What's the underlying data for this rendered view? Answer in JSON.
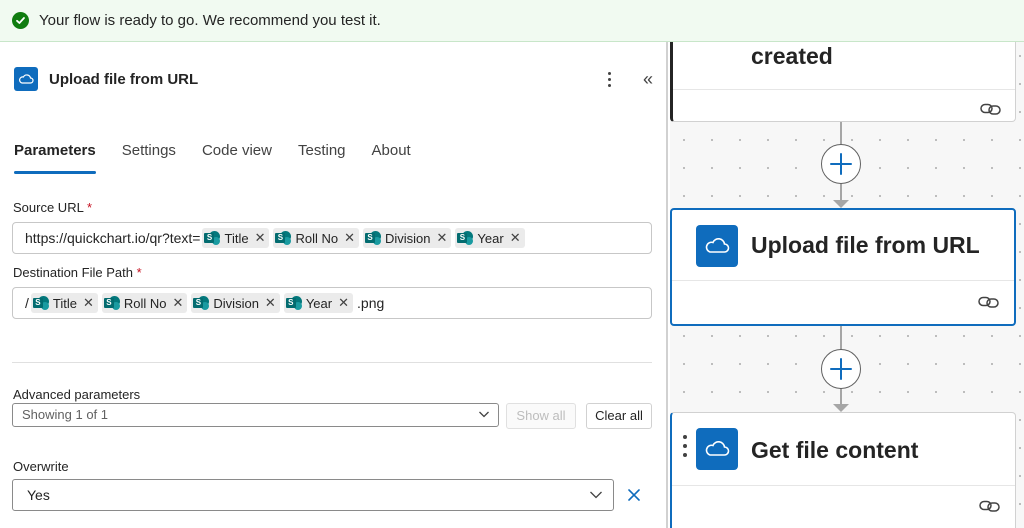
{
  "banner": {
    "message": "Your flow is ready to go. We recommend you test it."
  },
  "panel": {
    "title": "Upload file from URL",
    "tabs": [
      {
        "label": "Parameters",
        "active": true
      },
      {
        "label": "Settings",
        "active": false
      },
      {
        "label": "Code view",
        "active": false
      },
      {
        "label": "Testing",
        "active": false
      },
      {
        "label": "About",
        "active": false
      }
    ],
    "source_url": {
      "label": "Source URL",
      "required_mark": "*",
      "prefix": "https://quickchart.io/qr?text=",
      "tokens": [
        "Title",
        "Roll No",
        "Division",
        "Year"
      ]
    },
    "destination": {
      "label": "Destination File Path",
      "required_mark": "*",
      "prefix": "/",
      "tokens": [
        "Title",
        "Roll No",
        "Division",
        "Year"
      ],
      "suffix": ".png"
    },
    "advanced": {
      "label": "Advanced parameters",
      "selected": "Showing 1 of 1",
      "show_all": "Show all",
      "clear_all": "Clear all"
    },
    "overwrite": {
      "label": "Overwrite",
      "value": "Yes"
    }
  },
  "canvas": {
    "cards": [
      {
        "title": "created"
      },
      {
        "title": "Upload file from URL",
        "selected": true
      },
      {
        "title": "Get file content"
      }
    ]
  },
  "colors": {
    "accent": "#0f6cbd",
    "success": "#107c10",
    "sharepoint": "#03787c",
    "required": "#c50f1f"
  },
  "icons": {
    "banner": "checkmark-circle-icon",
    "service": "onedrive-cloud-icon",
    "token": "sharepoint-icon",
    "card_link": "link-icon",
    "add": "plus-icon"
  }
}
